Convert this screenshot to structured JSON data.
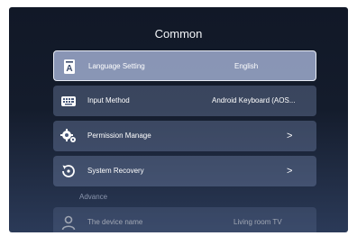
{
  "page": {
    "title": "Common"
  },
  "items": [
    {
      "icon": "language-icon",
      "label": "Language Setting",
      "value": "English",
      "selected": true
    },
    {
      "icon": "keyboard-icon",
      "label": "Input Method",
      "value": "Android Keyboard (AOS..."
    },
    {
      "icon": "permission-gear-icon",
      "label": "Permission Manage",
      "chevron": ">"
    },
    {
      "icon": "system-recovery-icon",
      "label": "System Recovery",
      "chevron": ">"
    }
  ],
  "advance": {
    "section_label": "Advance",
    "items": [
      {
        "icon": "device-person-icon",
        "label": "The device name",
        "value": "Living room TV"
      }
    ]
  },
  "colors": {
    "background_top": "#111827",
    "background_bottom": "#2b3a58",
    "selected_item": "#aab9dc"
  }
}
